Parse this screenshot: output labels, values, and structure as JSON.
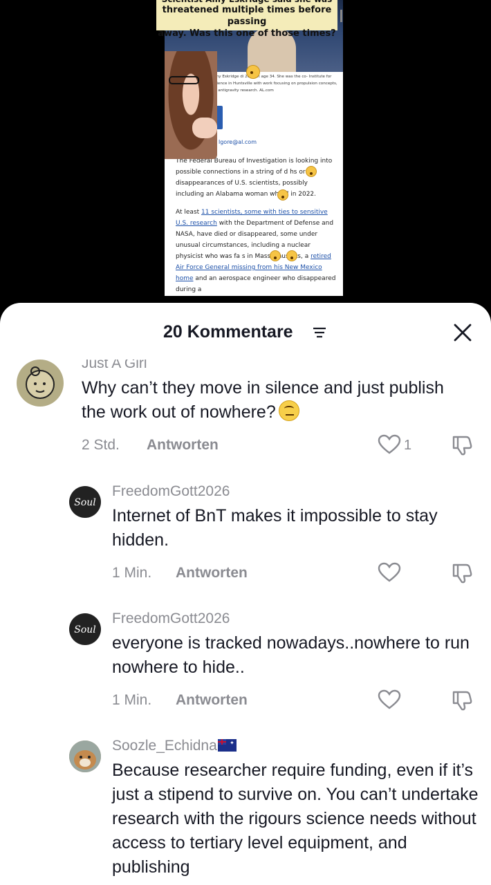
{
  "video": {
    "caption_line_clipped": "Scientist Amy Eskridge said she was",
    "caption_line_1": "threatened multiple times before passing",
    "caption_line_2": "away. Was this one of those times?",
    "photo_caption": "sident Amy Eskridge di   2022 at age 34. She was the co- Institute for Exotic Science in Huntsville with work focusing on propulsion concepts, including antigravity research.  AL.com",
    "fb_logo": "F",
    "email": "lgore@al.com",
    "para1": "The Federal Bureau of Investigation is looking into possible connections in a string of d    hs or disappearances of U.S. scientists, possibly including an Alabama woman who    d in 2022.",
    "para2_start": "At least ",
    "para2_link1": "11 scientists, some with ties to sensitive U.S. research",
    "para2_mid": " with the Department of Defense and NASA, have died or disappeared, some under unusual circumstances, including a nuclear physicist who was fa    s    in Massachusetts, a ",
    "para2_link2": "retired Air Force General missing from his New Mexico home",
    "para2_end": " and an aerospace engineer who disappeared during a"
  },
  "sheet": {
    "title": "20 Kommentare",
    "filter_icon": "filter-lines-icon",
    "close_icon": "close-x-icon"
  },
  "comments": [
    {
      "name": "Just A Girl",
      "text": "Why can’t they move in silence and just publish the work out of nowhere?",
      "emoji": "face-with-rolling-eyes",
      "time": "2 Std.",
      "reply": "Antworten",
      "likes": "1"
    },
    {
      "name": "FreedomGott2026",
      "text": "Internet of BnT makes it impossible to stay hidden.",
      "time": "1 Min.",
      "reply": "Antworten"
    },
    {
      "name": "FreedomGott2026",
      "text": "everyone is tracked nowadays..nowhere to run nowhere to hide..",
      "time": "1 Min.",
      "reply": "Antworten"
    },
    {
      "name": "Soozle_Echidna",
      "flag": "australia-flag",
      "text": "Because researcher require funding, even if it’s just a stipend to survive on. You can’t undertake research with the rigours science needs without access to tertiary level equipment, and publishing"
    }
  ],
  "colors": {
    "text": "#161823",
    "meta": "#8a8b91",
    "caption_bg": "#f4ecb9",
    "link": "#1b4fa8"
  }
}
